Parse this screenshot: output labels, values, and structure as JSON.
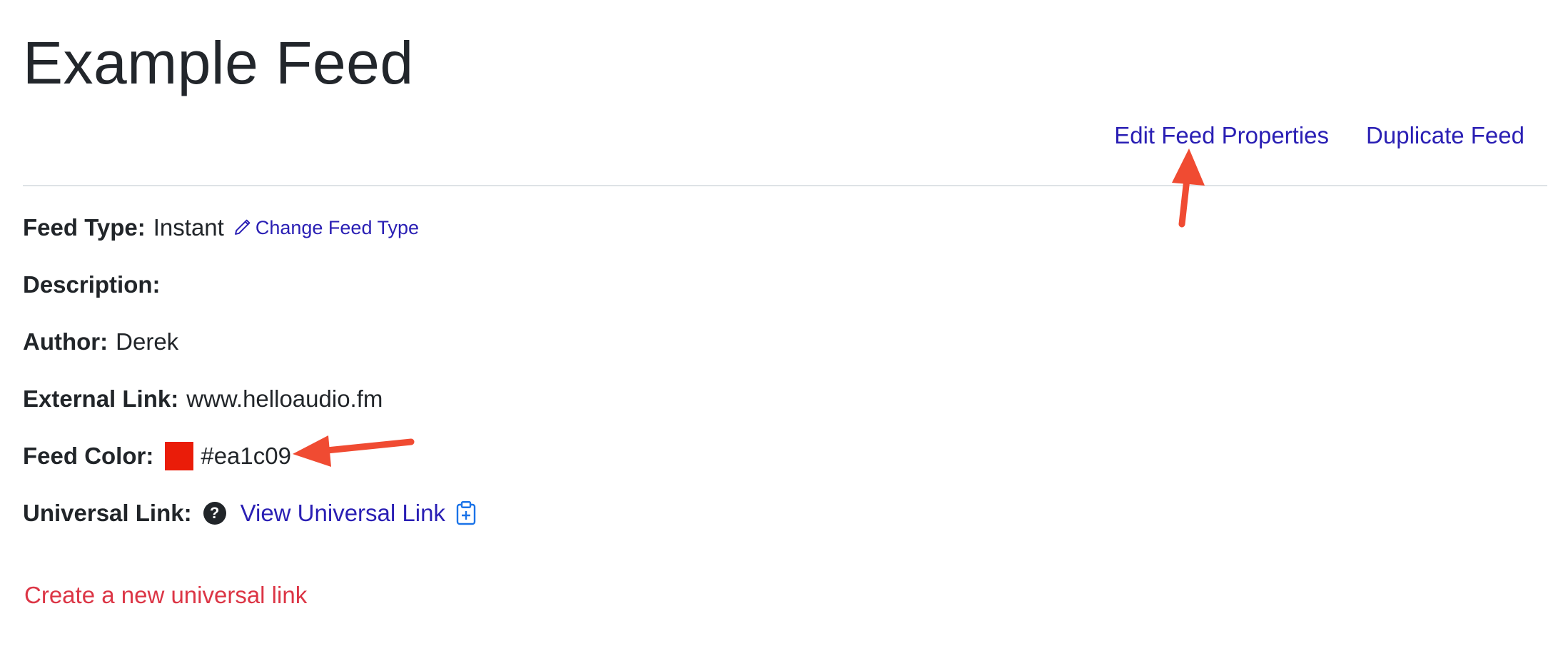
{
  "page": {
    "title": "Example Feed"
  },
  "actions": {
    "edit_label": "Edit Feed Properties",
    "duplicate_label": "Duplicate Feed"
  },
  "details": {
    "feed_type": {
      "label": "Feed Type:",
      "value": "Instant",
      "change_label": "Change Feed Type",
      "icon": "pencil-icon"
    },
    "description": {
      "label": "Description:",
      "value": ""
    },
    "author": {
      "label": "Author:",
      "value": "Derek"
    },
    "external_link": {
      "label": "External Link:",
      "value": "www.helloaudio.fm"
    },
    "feed_color": {
      "label": "Feed Color:",
      "value": "#ea1c09",
      "swatch": "#ea1c09"
    },
    "universal_link": {
      "label": "Universal Link:",
      "help_glyph": "?",
      "link_label": "View Universal Link",
      "help_icon": "question-circle-icon",
      "copy_icon": "clipboard-plus-icon"
    }
  },
  "create_link_label": "Create a new universal link",
  "colors": {
    "link": "#2a1fb4",
    "danger": "#dc3545",
    "annotation_arrow": "#f04b32"
  }
}
